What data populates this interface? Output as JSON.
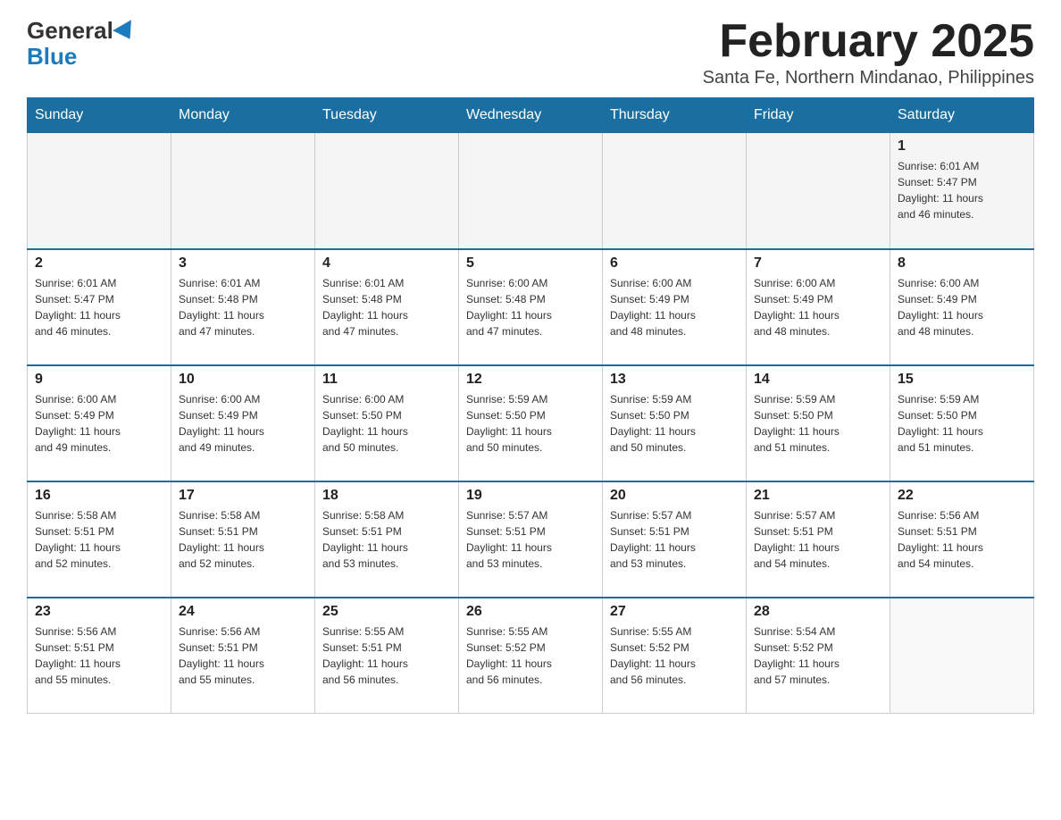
{
  "header": {
    "logo_general": "General",
    "logo_blue": "Blue",
    "month_year": "February 2025",
    "location": "Santa Fe, Northern Mindanao, Philippines"
  },
  "days_of_week": [
    "Sunday",
    "Monday",
    "Tuesday",
    "Wednesday",
    "Thursday",
    "Friday",
    "Saturday"
  ],
  "weeks": [
    {
      "days": [
        {
          "number": "",
          "info": ""
        },
        {
          "number": "",
          "info": ""
        },
        {
          "number": "",
          "info": ""
        },
        {
          "number": "",
          "info": ""
        },
        {
          "number": "",
          "info": ""
        },
        {
          "number": "",
          "info": ""
        },
        {
          "number": "1",
          "info": "Sunrise: 6:01 AM\nSunset: 5:47 PM\nDaylight: 11 hours\nand 46 minutes."
        }
      ]
    },
    {
      "days": [
        {
          "number": "2",
          "info": "Sunrise: 6:01 AM\nSunset: 5:47 PM\nDaylight: 11 hours\nand 46 minutes."
        },
        {
          "number": "3",
          "info": "Sunrise: 6:01 AM\nSunset: 5:48 PM\nDaylight: 11 hours\nand 47 minutes."
        },
        {
          "number": "4",
          "info": "Sunrise: 6:01 AM\nSunset: 5:48 PM\nDaylight: 11 hours\nand 47 minutes."
        },
        {
          "number": "5",
          "info": "Sunrise: 6:00 AM\nSunset: 5:48 PM\nDaylight: 11 hours\nand 47 minutes."
        },
        {
          "number": "6",
          "info": "Sunrise: 6:00 AM\nSunset: 5:49 PM\nDaylight: 11 hours\nand 48 minutes."
        },
        {
          "number": "7",
          "info": "Sunrise: 6:00 AM\nSunset: 5:49 PM\nDaylight: 11 hours\nand 48 minutes."
        },
        {
          "number": "8",
          "info": "Sunrise: 6:00 AM\nSunset: 5:49 PM\nDaylight: 11 hours\nand 48 minutes."
        }
      ]
    },
    {
      "days": [
        {
          "number": "9",
          "info": "Sunrise: 6:00 AM\nSunset: 5:49 PM\nDaylight: 11 hours\nand 49 minutes."
        },
        {
          "number": "10",
          "info": "Sunrise: 6:00 AM\nSunset: 5:49 PM\nDaylight: 11 hours\nand 49 minutes."
        },
        {
          "number": "11",
          "info": "Sunrise: 6:00 AM\nSunset: 5:50 PM\nDaylight: 11 hours\nand 50 minutes."
        },
        {
          "number": "12",
          "info": "Sunrise: 5:59 AM\nSunset: 5:50 PM\nDaylight: 11 hours\nand 50 minutes."
        },
        {
          "number": "13",
          "info": "Sunrise: 5:59 AM\nSunset: 5:50 PM\nDaylight: 11 hours\nand 50 minutes."
        },
        {
          "number": "14",
          "info": "Sunrise: 5:59 AM\nSunset: 5:50 PM\nDaylight: 11 hours\nand 51 minutes."
        },
        {
          "number": "15",
          "info": "Sunrise: 5:59 AM\nSunset: 5:50 PM\nDaylight: 11 hours\nand 51 minutes."
        }
      ]
    },
    {
      "days": [
        {
          "number": "16",
          "info": "Sunrise: 5:58 AM\nSunset: 5:51 PM\nDaylight: 11 hours\nand 52 minutes."
        },
        {
          "number": "17",
          "info": "Sunrise: 5:58 AM\nSunset: 5:51 PM\nDaylight: 11 hours\nand 52 minutes."
        },
        {
          "number": "18",
          "info": "Sunrise: 5:58 AM\nSunset: 5:51 PM\nDaylight: 11 hours\nand 53 minutes."
        },
        {
          "number": "19",
          "info": "Sunrise: 5:57 AM\nSunset: 5:51 PM\nDaylight: 11 hours\nand 53 minutes."
        },
        {
          "number": "20",
          "info": "Sunrise: 5:57 AM\nSunset: 5:51 PM\nDaylight: 11 hours\nand 53 minutes."
        },
        {
          "number": "21",
          "info": "Sunrise: 5:57 AM\nSunset: 5:51 PM\nDaylight: 11 hours\nand 54 minutes."
        },
        {
          "number": "22",
          "info": "Sunrise: 5:56 AM\nSunset: 5:51 PM\nDaylight: 11 hours\nand 54 minutes."
        }
      ]
    },
    {
      "days": [
        {
          "number": "23",
          "info": "Sunrise: 5:56 AM\nSunset: 5:51 PM\nDaylight: 11 hours\nand 55 minutes."
        },
        {
          "number": "24",
          "info": "Sunrise: 5:56 AM\nSunset: 5:51 PM\nDaylight: 11 hours\nand 55 minutes."
        },
        {
          "number": "25",
          "info": "Sunrise: 5:55 AM\nSunset: 5:51 PM\nDaylight: 11 hours\nand 56 minutes."
        },
        {
          "number": "26",
          "info": "Sunrise: 5:55 AM\nSunset: 5:52 PM\nDaylight: 11 hours\nand 56 minutes."
        },
        {
          "number": "27",
          "info": "Sunrise: 5:55 AM\nSunset: 5:52 PM\nDaylight: 11 hours\nand 56 minutes."
        },
        {
          "number": "28",
          "info": "Sunrise: 5:54 AM\nSunset: 5:52 PM\nDaylight: 11 hours\nand 57 minutes."
        },
        {
          "number": "",
          "info": ""
        }
      ]
    }
  ]
}
